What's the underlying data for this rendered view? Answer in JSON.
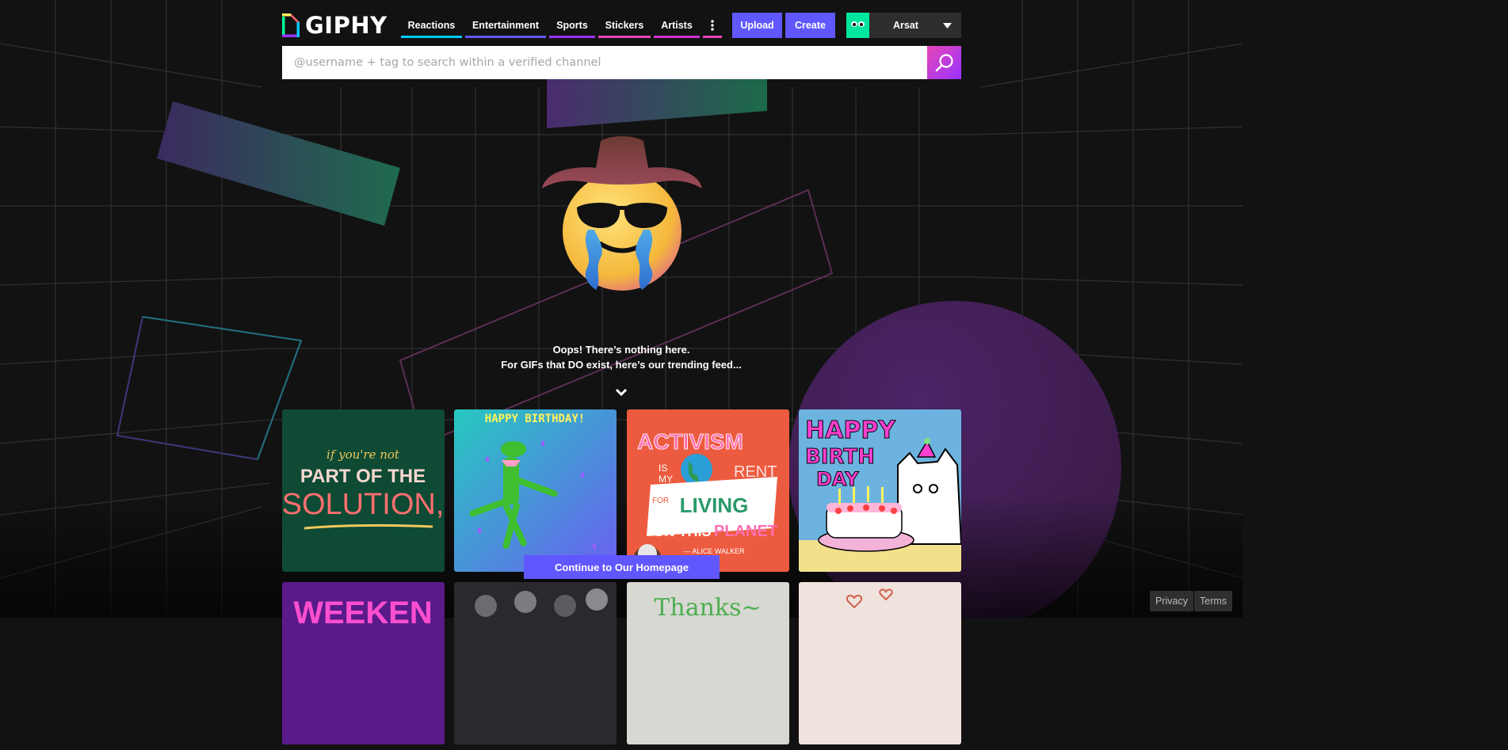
{
  "brand": {
    "name": "GIPHY"
  },
  "nav": {
    "items": [
      {
        "label": "Reactions",
        "color": "#00ccff"
      },
      {
        "label": "Entertainment",
        "color": "#6157ff"
      },
      {
        "label": "Sports",
        "color": "#9933ff"
      },
      {
        "label": "Stickers",
        "color": "#e646b6"
      },
      {
        "label": "Artists",
        "color": "#ff6666"
      }
    ],
    "more_icon": "more-vertical-icon"
  },
  "actions": {
    "upload_label": "Upload",
    "create_label": "Create",
    "accent": "#6157ff"
  },
  "user": {
    "name": "Arsat",
    "avatar_color": "#00e6a0"
  },
  "search": {
    "placeholder": "@username + tag to search within a verified channel",
    "icon": "search-icon"
  },
  "message": {
    "line1": "Oops! There’s nothing here.",
    "line2": "For GIFs that DO exist, here’s our trending feed..."
  },
  "tiles": [
    {
      "id": "solution",
      "lines": [
        "if you're not",
        "PART OF THE",
        "SOLUTION,"
      ]
    },
    {
      "id": "birthday-frog",
      "lines": [
        "HAPPY BIRTHDAY!"
      ]
    },
    {
      "id": "activism",
      "lines": [
        "ACTIVISM",
        "IS",
        "MY",
        "RENT",
        "FOR",
        "LIVING",
        "ON THIS",
        "PLANET",
        "— ALICE WALKER"
      ]
    },
    {
      "id": "happy-birthday-cat",
      "lines": [
        "HAPPY",
        "BIRTH",
        "DAY"
      ]
    },
    {
      "id": "weekend",
      "lines": [
        "WEEKEN"
      ]
    },
    {
      "id": "crowd",
      "lines": []
    },
    {
      "id": "thanks",
      "lines": [
        "Thanks~"
      ]
    },
    {
      "id": "hearts",
      "lines": []
    }
  ],
  "continue_label": "Continue to Our Homepage",
  "footer": {
    "privacy": "Privacy",
    "terms": "Terms"
  }
}
